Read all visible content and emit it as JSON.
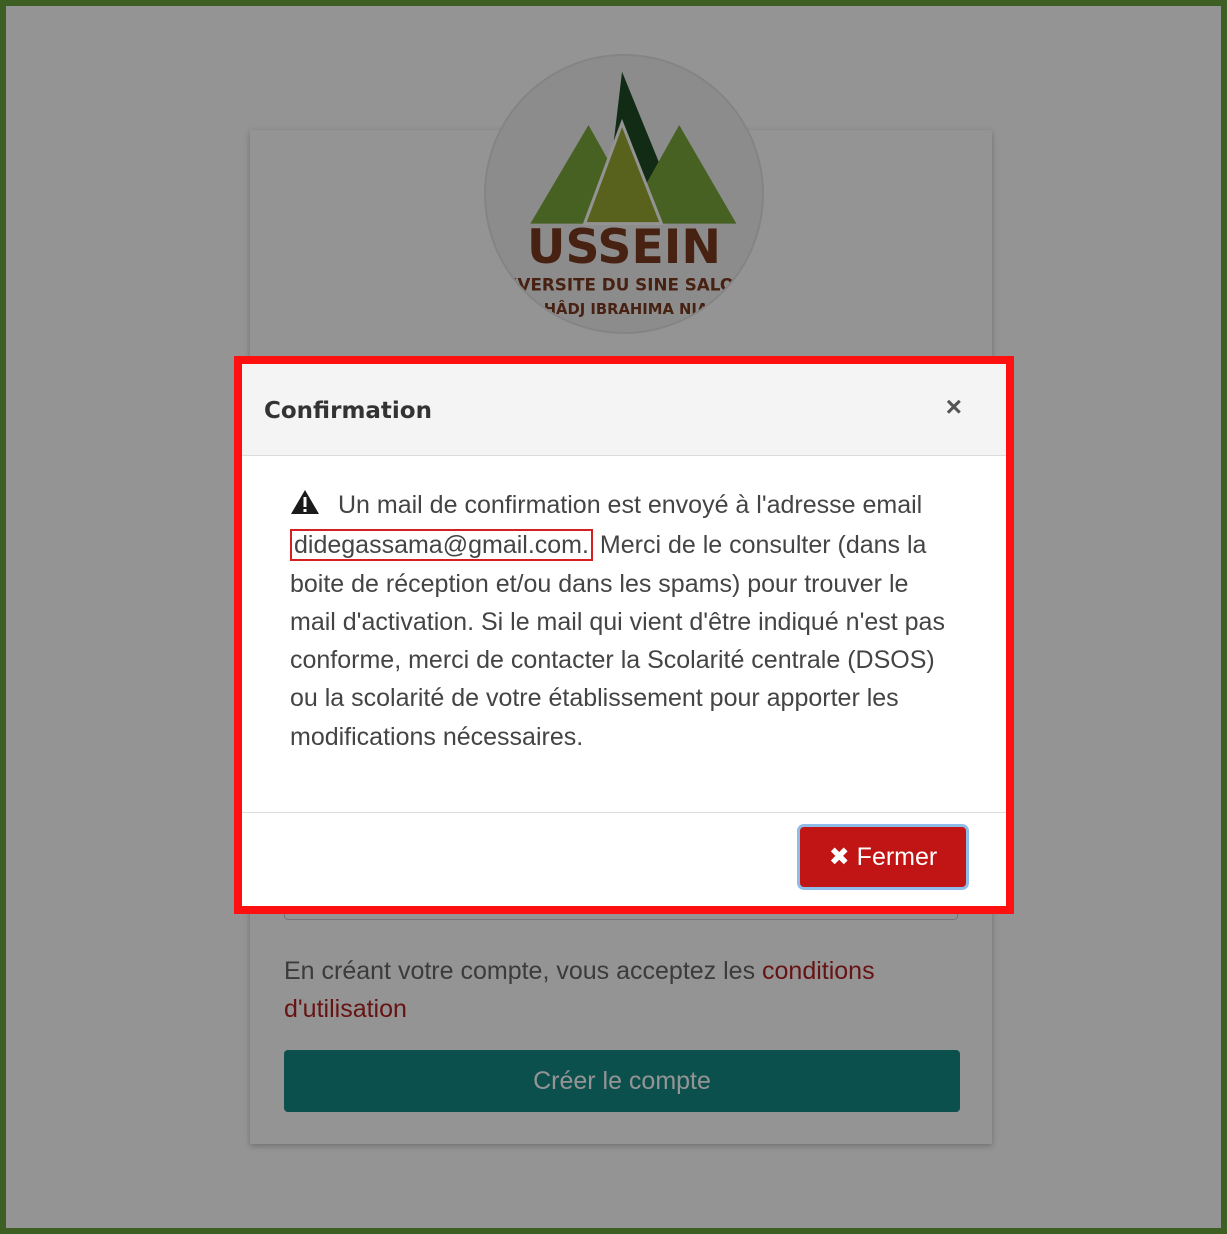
{
  "logo": {
    "name": "USSEIN",
    "line1": "UNIVERSITE DU SINE SALOUM",
    "line2": "EL HÂDJ IBRAHIMA NIASS"
  },
  "form": {
    "terms_prefix": "En créant votre compte, vous acceptez les ",
    "terms_link": "conditions d'utilisation",
    "create_button": "Créer le compte"
  },
  "modal": {
    "title": "Confirmation",
    "close_symbol": "×",
    "message_before": "Un mail de confirmation est envoyé à l'adresse email ",
    "email": "didegassama@gmail.com.",
    "message_after": " Merci de le consulter (dans la boite de réception et/ou dans les spams) pour trouver le mail d'activation. Si le mail qui vient d'être indiqué n'est pas conforme, merci de contacter la Scolarité centrale (DSOS) ou la scolarité de votre établissement pour apporter les modifications nécessaires.",
    "close_button": "Fermer",
    "icons": {
      "warning": "warning-icon",
      "close": "close-icon"
    }
  },
  "colors": {
    "frame_border": "#3e5f24",
    "primary_button": "#168a86",
    "danger_button": "#c11414",
    "highlight": "#ff1010",
    "link": "#b22222"
  }
}
